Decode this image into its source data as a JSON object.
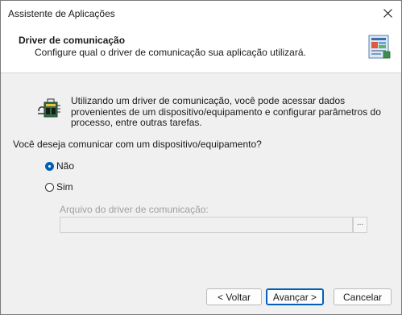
{
  "window": {
    "title": "Assistente de Aplicações"
  },
  "header": {
    "title": "Driver de comunicação",
    "subtitle": "Configure qual o driver de comunicação sua aplicação utilizará."
  },
  "info": {
    "text": "Utilizando um driver de comunicação, você pode acessar dados provenientes de um dispositivo/equipamento e configurar parâmetros do processo, entre outras tarefas."
  },
  "question": "Você deseja comunicar com um dispositivo/equipamento?",
  "options": [
    {
      "label": "Não",
      "selected": true
    },
    {
      "label": "Sim",
      "selected": false
    }
  ],
  "driver_file": {
    "label": "Arquivo do driver de comunicação:",
    "value": "",
    "browse_label": "..."
  },
  "buttons": {
    "back": "< Voltar",
    "next": "Avançar >",
    "cancel": "Cancelar"
  },
  "colors": {
    "accent": "#005fb8"
  }
}
